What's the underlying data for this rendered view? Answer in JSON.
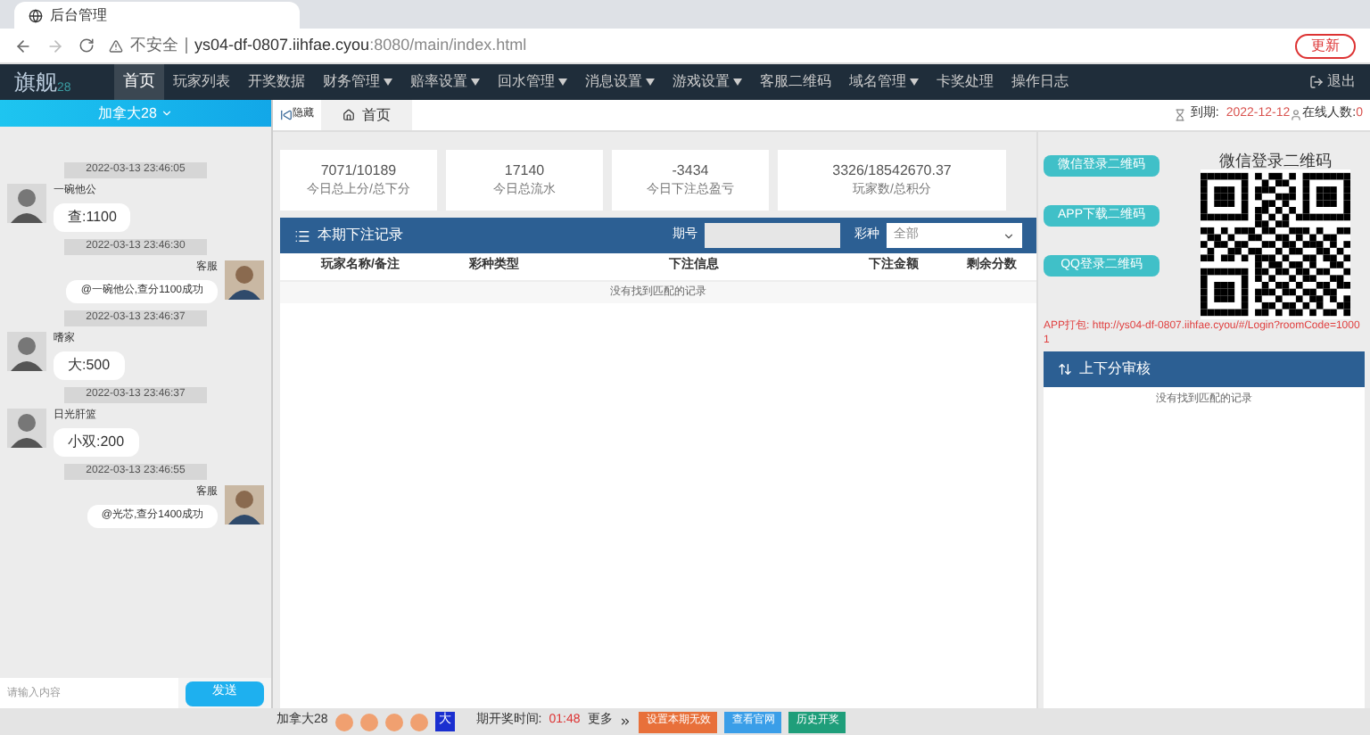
{
  "browser": {
    "tab_title": "后台管理",
    "security": "不安全",
    "url_host": "ys04-df-0807.iihfae.cyou",
    "url_path": ":8080/main/index.html",
    "update_button": "更新"
  },
  "nav": {
    "logo": "旗舰",
    "logo_suffix": "28",
    "items": [
      {
        "label": "首页",
        "selected": true,
        "dropdown": false
      },
      {
        "label": "玩家列表",
        "selected": false,
        "dropdown": false
      },
      {
        "label": "开奖数据",
        "selected": false,
        "dropdown": false
      },
      {
        "label": "财务管理",
        "selected": false,
        "dropdown": true
      },
      {
        "label": "赔率设置",
        "selected": false,
        "dropdown": true
      },
      {
        "label": "回水管理",
        "selected": false,
        "dropdown": true
      },
      {
        "label": "消息设置",
        "selected": false,
        "dropdown": true
      },
      {
        "label": "游戏设置",
        "selected": false,
        "dropdown": true
      },
      {
        "label": "客服二维码",
        "selected": false,
        "dropdown": false
      },
      {
        "label": "域名管理",
        "selected": false,
        "dropdown": true
      },
      {
        "label": "卡奖处理",
        "selected": false,
        "dropdown": false
      },
      {
        "label": "操作日志",
        "selected": false,
        "dropdown": false
      }
    ],
    "logout": "退出"
  },
  "chat": {
    "room": "加拿大28",
    "messages": [
      {
        "time": "2022-03-13 23:46:05",
        "kind": "incoming",
        "name": "一碗他公",
        "text": "查:1100"
      },
      {
        "time": "2022-03-13 23:46:30",
        "kind": "outgoing",
        "name": "客服",
        "text": "@一碗他公,查分1100成功"
      },
      {
        "time": "2022-03-13 23:46:37",
        "kind": "incoming",
        "name": "嗜家",
        "text": "大:500"
      },
      {
        "time": "2022-03-13 23:46:37",
        "kind": "incoming",
        "name": "日光肝篮",
        "text": "小双:200"
      },
      {
        "time": "2022-03-13 23:46:55",
        "kind": "outgoing",
        "name": "客服",
        "text": "@光芯,查分1400成功"
      }
    ],
    "input_placeholder": "请输入内容",
    "send_button": "发送"
  },
  "breadcrumb": {
    "hide": "隐藏",
    "home": "首页",
    "expire_label": "到期:",
    "expire_date": "2022-12-12",
    "online_label": "在线人数:",
    "online_count": "0"
  },
  "stats": [
    {
      "value": "7071/10189",
      "label": "今日总上分/总下分"
    },
    {
      "value": "17140",
      "label": "今日总流水"
    },
    {
      "value": "-3434",
      "label": "今日下注总盈亏"
    },
    {
      "value": "3326/18542670.37",
      "label": "玩家数/总积分"
    }
  ],
  "bets": {
    "title": "本期下注记录",
    "period_label": "期号",
    "lottery_label": "彩种",
    "lottery_value": "全部",
    "columns": [
      "玩家名称/备注",
      "彩种类型",
      "下注信息",
      "下注金额",
      "剩余分数"
    ],
    "empty": "没有找到匹配的记录"
  },
  "qr": {
    "buttons": [
      "微信登录二维码",
      "APP下载二维码",
      "QQ登录二维码"
    ],
    "title": "微信登录二维码",
    "app_label": "APP打包:",
    "app_link": "http://ys04-df-0807.iihfae.cyou/#/Login?roomCode=10001"
  },
  "audit": {
    "title": "上下分审核",
    "empty": "没有找到匹配的记录"
  },
  "bottom": {
    "lottery": "加拿大28",
    "result_big": "大",
    "countdown_label": "期开奖时间:",
    "countdown": "01:48",
    "more": "更多",
    "buttons": [
      {
        "label": "设置本期无效",
        "color": "#e8703a"
      },
      {
        "label": "查看官网",
        "color": "#3a9ee8"
      },
      {
        "label": "历史开奖",
        "color": "#1f9e7a"
      }
    ]
  }
}
